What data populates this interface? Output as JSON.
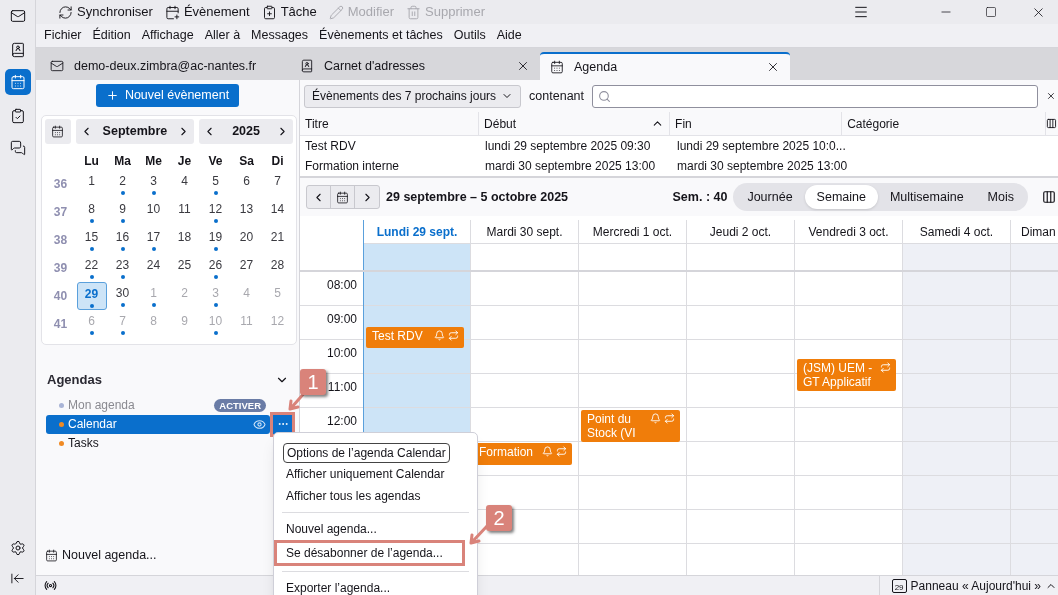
{
  "toolbar": [
    {
      "label": "Synchroniser",
      "disabled": false
    },
    {
      "label": "Évènement",
      "disabled": false
    },
    {
      "label": "Tâche",
      "disabled": false
    },
    {
      "label": "Modifier",
      "disabled": true
    },
    {
      "label": "Supprimer",
      "disabled": true
    }
  ],
  "menu": [
    "Fichier",
    "Édition",
    "Affichage",
    "Aller à",
    "Messages",
    "Évènements et tâches",
    "Outils",
    "Aide"
  ],
  "tabs": [
    {
      "label": "demo-deux.zimbra@ac-nantes.fr",
      "kind": "mail",
      "selected": false,
      "closable": false
    },
    {
      "label": "Carnet d'adresses",
      "kind": "contacts",
      "selected": false,
      "closable": true
    },
    {
      "label": "Agenda",
      "kind": "calendar",
      "selected": true,
      "closable": true
    }
  ],
  "sidebar": {
    "new_event": "Nouvel évènement",
    "mini_calendar": {
      "month": "Septembre",
      "year": "2025",
      "weekdays": [
        "Lu",
        "Ma",
        "Me",
        "Je",
        "Ve",
        "Sa",
        "Di"
      ],
      "weeks": [
        {
          "number": "36",
          "days": [
            {
              "label": "1",
              "other_month": false,
              "has_events": false,
              "selected": false
            },
            {
              "label": "2",
              "other_month": false,
              "has_events": true,
              "selected": false
            },
            {
              "label": "3",
              "other_month": false,
              "has_events": true,
              "selected": false
            },
            {
              "label": "4",
              "other_month": false,
              "has_events": false,
              "selected": false
            },
            {
              "label": "5",
              "other_month": false,
              "has_events": true,
              "selected": false
            },
            {
              "label": "6",
              "other_month": false,
              "has_events": false,
              "selected": false
            },
            {
              "label": "7",
              "other_month": false,
              "has_events": false,
              "selected": false
            }
          ]
        },
        {
          "number": "37",
          "days": [
            {
              "label": "8",
              "other_month": false,
              "has_events": true,
              "selected": false
            },
            {
              "label": "9",
              "other_month": false,
              "has_events": true,
              "selected": false
            },
            {
              "label": "10",
              "other_month": false,
              "has_events": false,
              "selected": false
            },
            {
              "label": "11",
              "other_month": false,
              "has_events": false,
              "selected": false
            },
            {
              "label": "12",
              "other_month": false,
              "has_events": true,
              "selected": false
            },
            {
              "label": "13",
              "other_month": false,
              "has_events": false,
              "selected": false
            },
            {
              "label": "14",
              "other_month": false,
              "has_events": false,
              "selected": false
            }
          ]
        },
        {
          "number": "38",
          "days": [
            {
              "label": "15",
              "other_month": false,
              "has_events": true,
              "selected": false
            },
            {
              "label": "16",
              "other_month": false,
              "has_events": true,
              "selected": false
            },
            {
              "label": "17",
              "other_month": false,
              "has_events": true,
              "selected": false
            },
            {
              "label": "18",
              "other_month": false,
              "has_events": false,
              "selected": false
            },
            {
              "label": "19",
              "other_month": false,
              "has_events": true,
              "selected": false
            },
            {
              "label": "20",
              "other_month": false,
              "has_events": false,
              "selected": false
            },
            {
              "label": "21",
              "other_month": false,
              "has_events": false,
              "selected": false
            }
          ]
        },
        {
          "number": "39",
          "days": [
            {
              "label": "22",
              "other_month": false,
              "has_events": true,
              "selected": false
            },
            {
              "label": "23",
              "other_month": false,
              "has_events": true,
              "selected": false
            },
            {
              "label": "24",
              "other_month": false,
              "has_events": false,
              "selected": false
            },
            {
              "label": "25",
              "other_month": false,
              "has_events": false,
              "selected": false
            },
            {
              "label": "26",
              "other_month": false,
              "has_events": true,
              "selected": false
            },
            {
              "label": "27",
              "other_month": false,
              "has_events": false,
              "selected": false
            },
            {
              "label": "28",
              "other_month": false,
              "has_events": false,
              "selected": false
            }
          ]
        },
        {
          "number": "40",
          "days": [
            {
              "label": "29",
              "other_month": false,
              "has_events": true,
              "selected": true
            },
            {
              "label": "30",
              "other_month": false,
              "has_events": true,
              "selected": false
            },
            {
              "label": "1",
              "other_month": true,
              "has_events": true,
              "selected": false
            },
            {
              "label": "2",
              "other_month": true,
              "has_events": false,
              "selected": false
            },
            {
              "label": "3",
              "other_month": true,
              "has_events": true,
              "selected": false
            },
            {
              "label": "4",
              "other_month": true,
              "has_events": false,
              "selected": false
            },
            {
              "label": "5",
              "other_month": true,
              "has_events": false,
              "selected": false
            }
          ]
        },
        {
          "number": "41",
          "days": [
            {
              "label": "6",
              "other_month": true,
              "has_events": true,
              "selected": false
            },
            {
              "label": "7",
              "other_month": true,
              "has_events": true,
              "selected": false
            },
            {
              "label": "8",
              "other_month": true,
              "has_events": false,
              "selected": false
            },
            {
              "label": "9",
              "other_month": true,
              "has_events": false,
              "selected": false
            },
            {
              "label": "10",
              "other_month": true,
              "has_events": true,
              "selected": false
            },
            {
              "label": "11",
              "other_month": true,
              "has_events": false,
              "selected": false
            },
            {
              "label": "12",
              "other_month": true,
              "has_events": false,
              "selected": false
            }
          ]
        }
      ]
    },
    "agendas": {
      "title": "Agendas",
      "expanded": true,
      "items": [
        {
          "name": "Mon agenda",
          "color": "#a9b4d6",
          "enabled": false,
          "badge": "ACTIVER",
          "selected": false
        },
        {
          "name": "Calendar",
          "color": "#f08a24",
          "enabled": true,
          "selected": true
        },
        {
          "name": "Tasks",
          "color": "#f08a24",
          "enabled": true,
          "selected": false
        }
      ]
    },
    "new_calendar": "Nouvel agenda..."
  },
  "filter": {
    "range": "Évènements des 7 prochains jours",
    "label": "contenant"
  },
  "event_list": {
    "columns": [
      {
        "label": "Titre",
        "sorted": false
      },
      {
        "label": "Début",
        "sorted": true
      },
      {
        "label": "Fin",
        "sorted": false
      },
      {
        "label": "Catégorie",
        "sorted": false
      }
    ],
    "rows": [
      {
        "title": "Test RDV",
        "start": "lundi 29 septembre 2025 09:30",
        "end": "lundi 29 septembre 2025 10:0..."
      },
      {
        "title": "Formation interne",
        "start": "mardi 30 septembre 2025 13:00",
        "end": "mardi 30 septembre 2025 13:00"
      }
    ]
  },
  "week_view": {
    "range": "29 septembre – 5 octobre 2025",
    "week": "Sem. : 40",
    "views": [
      {
        "label": "Journée",
        "selected": false
      },
      {
        "label": "Semaine",
        "selected": true
      },
      {
        "label": "Multisemaine",
        "selected": false
      },
      {
        "label": "Mois",
        "selected": false
      }
    ],
    "hours": [
      "08:00",
      "09:00",
      "10:00",
      "11:00",
      "12:00"
    ],
    "days": [
      {
        "label": "Lundi 29 sept.",
        "today": true,
        "weekend": false,
        "events": [
          {
            "title": "Test RDV",
            "reminder": true,
            "recurring": true
          }
        ]
      },
      {
        "label": "Mardi 30 sept.",
        "today": false,
        "weekend": false,
        "events": [
          {
            "title": "Formation",
            "reminder": true,
            "recurring": true
          }
        ]
      },
      {
        "label": "Mercredi 1 oct.",
        "today": false,
        "weekend": false,
        "events": [
          {
            "title": "Point du Stock (VI",
            "reminder": true,
            "recurring": true
          }
        ]
      },
      {
        "label": "Jeudi 2 oct.",
        "today": false,
        "weekend": false
      },
      {
        "label": "Vendredi 3 oct.",
        "today": false,
        "weekend": false,
        "events": [
          {
            "title": "(JSM) UEM - GT Applicatif",
            "reminder": false,
            "recurring": true
          }
        ]
      },
      {
        "label": "Samedi 4 oct.",
        "today": false,
        "weekend": true
      },
      {
        "label": "Diman",
        "today": false,
        "weekend": true
      }
    ]
  },
  "context_menu": {
    "tooltip": "Options de l’agenda Calendar",
    "items": [
      {
        "kind": "item",
        "label": "Afficher uniquement Calendar",
        "highlighted": false
      },
      {
        "kind": "item",
        "label": "Afficher tous les agendas",
        "highlighted": false
      },
      {
        "kind": "separator"
      },
      {
        "kind": "item",
        "label": "Nouvel agenda...",
        "highlighted": false
      },
      {
        "kind": "item",
        "label": "Se désabonner de l’agenda...",
        "highlighted": true
      },
      {
        "kind": "separator"
      },
      {
        "kind": "item",
        "label": "Exporter l’agenda...",
        "highlighted": false
      }
    ]
  },
  "annotations": [
    {
      "label": "1"
    },
    {
      "label": "2"
    }
  ],
  "status_bar": {
    "today_day": "29",
    "today_pane": "Panneau « Aujourd'hui »"
  }
}
